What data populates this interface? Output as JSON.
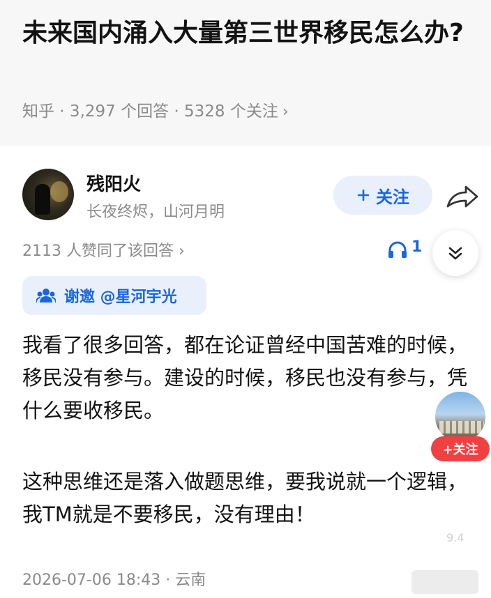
{
  "question": {
    "title": "未来国内涌入大量第三世界移民怎么办?",
    "meta": "知乎 · 3,297 个回答 · 5328 个关注",
    "meta_chevron": "›"
  },
  "author": {
    "name": "残阳火",
    "bio": "长夜终烬，山河月明",
    "follow_label": "关注",
    "follow_icon": "plus-icon",
    "share_icon": "share-icon"
  },
  "stats": {
    "likes_text": "2113 人赞同了该回答",
    "likes_chevron": "›",
    "listen_count": "1",
    "listen_icon": "headphones-icon",
    "collapse_icon": "double-chevron-down-icon"
  },
  "invite": {
    "text": "谢邀 @星河宇光"
  },
  "answer": {
    "paragraph_1": "我看了很多回答，都在论证曾经中国苦难的时候，移民没有参与。建设的时候，移民也没有参与，凭什么要收移民。",
    "paragraph_2": "这种思维还是落入做题思维，要我说就一个逻辑，我TM就是不要移民，没有理由！"
  },
  "floating": {
    "follow_label": "+关注",
    "count": "9.4"
  },
  "footer": {
    "timestamp": "2026-07-06 18:43 · 云南"
  },
  "colors": {
    "accent": "#1a66e0",
    "follow_bg": "#eaf0fb",
    "float_follow_bg": "#f04142",
    "question_bg": "#f7f7f8"
  }
}
